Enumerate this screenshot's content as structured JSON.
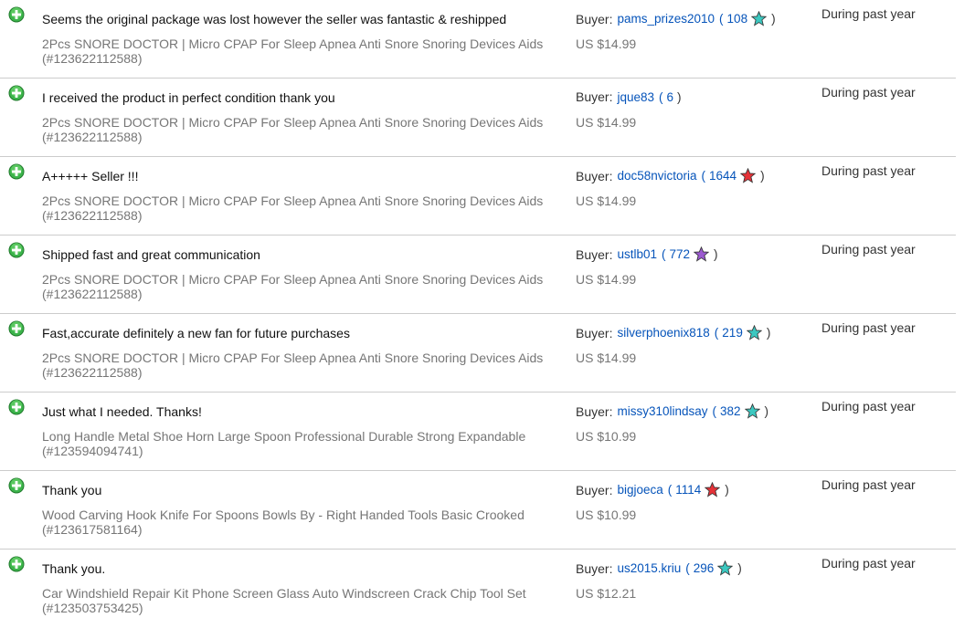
{
  "buyer_label": "Buyer:",
  "feedback": [
    {
      "comment": "Seems the original package was lost however the seller was fantastic & reshipped",
      "item": "2Pcs SNORE DOCTOR | Micro CPAP For Sleep Apnea Anti Snore Snoring Devices Aids (#123622112588)",
      "buyer": "pams_prizes2010",
      "score": "108",
      "star": "turquoise-star-icon",
      "star_color": "#3cc8c0",
      "price": "US $14.99",
      "when": "During past year"
    },
    {
      "comment": "I received the product in perfect condition thank you",
      "item": "2Pcs SNORE DOCTOR | Micro CPAP For Sleep Apnea Anti Snore Snoring Devices Aids (#123622112588)",
      "buyer": "jque83",
      "score": "6",
      "star": "",
      "star_color": "",
      "price": "US $14.99",
      "when": "During past year"
    },
    {
      "comment": "A+++++ Seller !!!",
      "item": "2Pcs SNORE DOCTOR | Micro CPAP For Sleep Apnea Anti Snore Snoring Devices Aids (#123622112588)",
      "buyer": "doc58nvictoria",
      "score": "1644",
      "star": "red-star-icon",
      "star_color": "#e53238",
      "price": "US $14.99",
      "when": "During past year"
    },
    {
      "comment": "Shipped fast and great communication",
      "item": "2Pcs SNORE DOCTOR | Micro CPAP For Sleep Apnea Anti Snore Snoring Devices Aids (#123622112588)",
      "buyer": "ustlb01",
      "score": "772",
      "star": "purple-star-icon",
      "star_color": "#9b59d0",
      "price": "US $14.99",
      "when": "During past year"
    },
    {
      "comment": "Fast,accurate definitely a new fan for future purchases",
      "item": "2Pcs SNORE DOCTOR | Micro CPAP For Sleep Apnea Anti Snore Snoring Devices Aids (#123622112588)",
      "buyer": "silverphoenix818",
      "score": "219",
      "star": "turquoise-star-icon",
      "star_color": "#3cc8c0",
      "price": "US $14.99",
      "when": "During past year"
    },
    {
      "comment": "Just what I needed. Thanks!",
      "item": "Long Handle Metal Shoe Horn Large Spoon Professional Durable Strong Expandable (#123594094741)",
      "buyer": "missy310lindsay",
      "score": "382",
      "star": "turquoise-star-icon",
      "star_color": "#3cc8c0",
      "price": "US $10.99",
      "when": "During past year"
    },
    {
      "comment": "Thank you",
      "item": "Wood Carving Hook Knife For Spoons Bowls By - Right Handed Tools Basic Crooked (#123617581164)",
      "buyer": "bigjoeca",
      "score": "1114",
      "star": "red-star-icon",
      "star_color": "#e53238",
      "price": "US $10.99",
      "when": "During past year"
    },
    {
      "comment": "Thank you.",
      "item": "Car Windshield Repair Kit Phone Screen Glass Auto Windscreen Crack Chip Tool Set (#123503753425)",
      "buyer": "us2015.kriu",
      "score": "296",
      "star": "turquoise-star-icon",
      "star_color": "#3cc8c0",
      "price": "US $12.21",
      "when": "During past year"
    }
  ]
}
